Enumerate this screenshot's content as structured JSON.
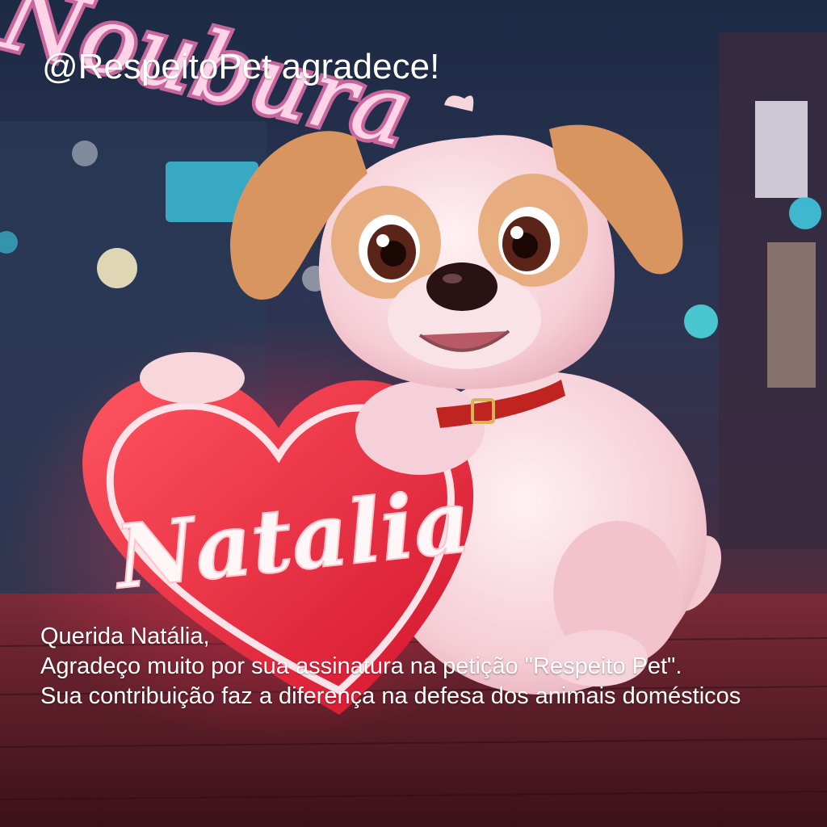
{
  "image": {
    "headline": "@RespeitoPet agradece!",
    "background_sign_text": "Noubura",
    "heart_sign_text": "Natalia",
    "message_lines": [
      "Querida Natália,",
      "Agradeço muito por sua assinatura na petição \"Respeito Pet\".",
      "Sua contribuição faz a diferença na defesa dos animais domésticos"
    ],
    "colors": {
      "neon_pink": "#ff4f9a",
      "heart_red": "#f2263d",
      "dog_fur": "#f7d6dc",
      "ear_tan": "#d99560",
      "text_white": "#ffffff"
    }
  }
}
